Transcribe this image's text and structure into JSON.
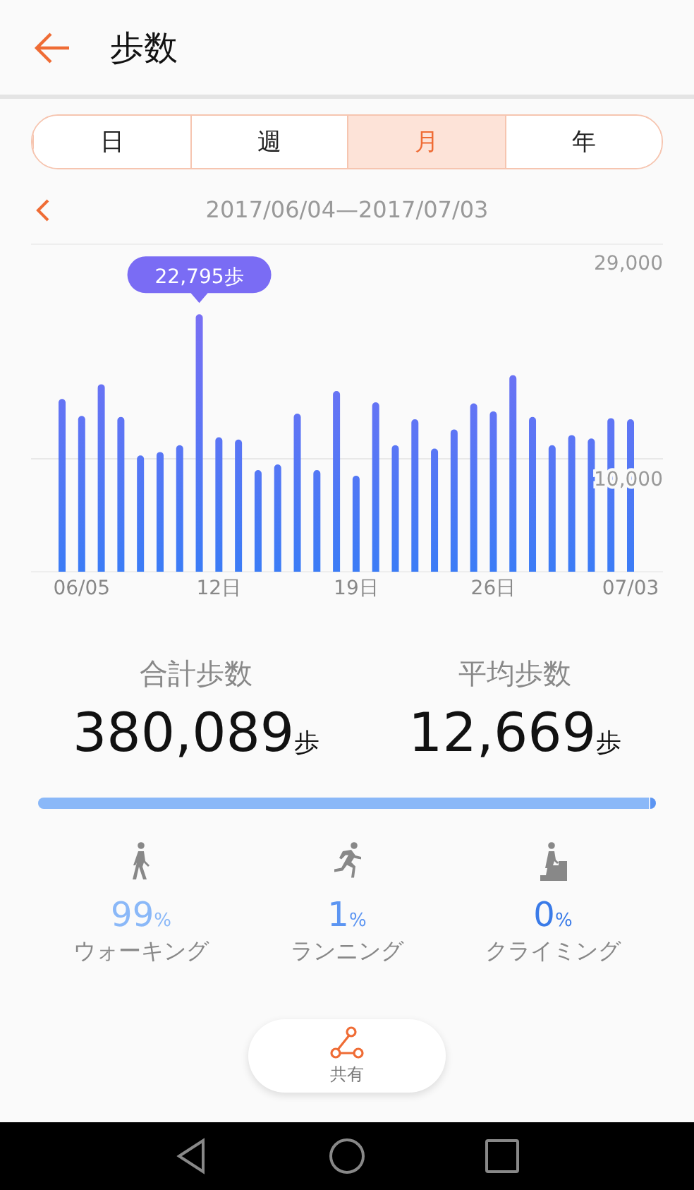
{
  "header": {
    "title": "歩数"
  },
  "tabs": [
    {
      "label": "日",
      "selected": false
    },
    {
      "label": "週",
      "selected": false
    },
    {
      "label": "月",
      "selected": true
    },
    {
      "label": "年",
      "selected": false
    }
  ],
  "date_range": "2017/06/04—2017/07/03",
  "chart_data": {
    "type": "bar",
    "categories": [
      null,
      "06/05",
      null,
      null,
      null,
      null,
      null,
      null,
      "12日",
      null,
      null,
      null,
      null,
      null,
      null,
      "19日",
      null,
      null,
      null,
      null,
      null,
      null,
      "26日",
      null,
      null,
      null,
      null,
      null,
      null,
      "07/03"
    ],
    "values": [
      15300,
      13800,
      16600,
      13700,
      10300,
      10600,
      11200,
      22795,
      11900,
      11700,
      9000,
      9500,
      14000,
      9000,
      16000,
      8500,
      15000,
      11200,
      13500,
      10900,
      12600,
      14900,
      14200,
      17400,
      13700,
      11200,
      12100,
      11800,
      13600,
      13500
    ],
    "ylim": [
      0,
      29000
    ],
    "yticks": [
      {
        "value": 10000,
        "label": "10,000"
      },
      {
        "value": 29000,
        "label": "29,000"
      }
    ],
    "annotations": [
      "22,795歩"
    ]
  },
  "stats": [
    {
      "label": "合計歩数",
      "value": "380,089",
      "unit": "歩"
    },
    {
      "label": "平均歩数",
      "value": "12,669",
      "unit": "歩"
    }
  ],
  "activities": [
    {
      "kind": "walking",
      "percent": "99",
      "unit": "%",
      "label": "ウォーキング",
      "level": 0.99,
      "color": "#8ab8f8"
    },
    {
      "kind": "running",
      "percent": "1",
      "unit": "%",
      "label": "ランニング",
      "level": 0.01,
      "color": "#5c95f2"
    },
    {
      "kind": "climbing",
      "percent": "0",
      "unit": "%",
      "label": "クライミング",
      "color": "#3a7be8"
    }
  ],
  "share": {
    "label": "共有"
  }
}
